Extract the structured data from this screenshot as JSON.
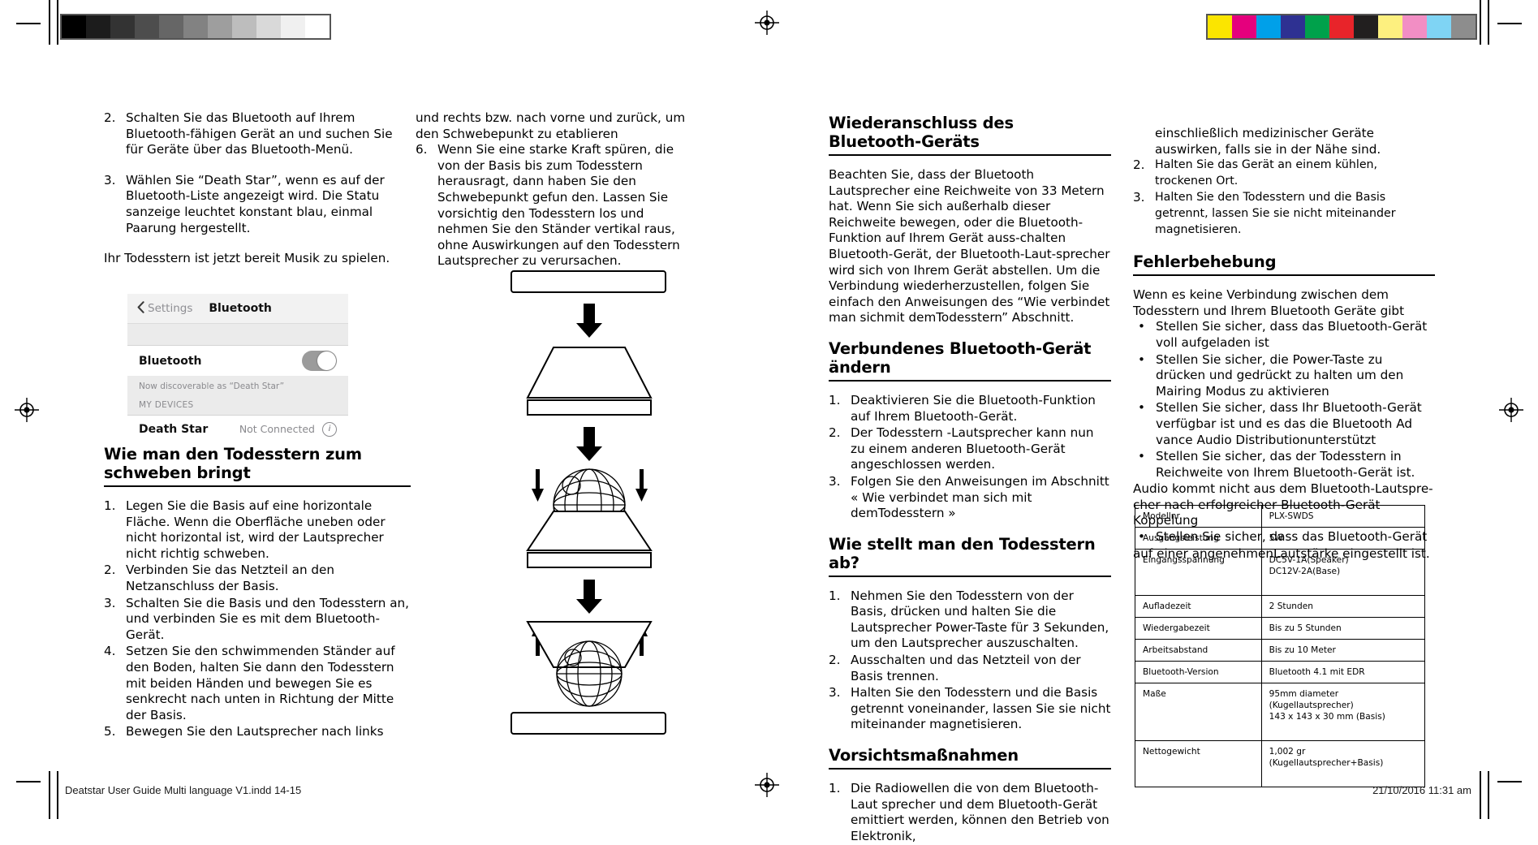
{
  "print_marks": {
    "footer_left": "Deatstar User Guide Multi language V1.indd   14-15",
    "footer_right": "21/10/2016   11:31 am",
    "gray_swatches": [
      "#000000",
      "#1c1c1c",
      "#333333",
      "#4d4d4d",
      "#666666",
      "#828282",
      "#9e9e9e",
      "#bdbdbd",
      "#d9d9d9",
      "#f0f0f0",
      "#ffffff"
    ],
    "color_swatches": [
      "#fbe500",
      "#e5007d",
      "#00a0e9",
      "#2e3192",
      "#00a14b",
      "#e8242a",
      "#221f1f",
      "#fdf07f",
      "#f28ec4",
      "#7fd4f4",
      "#8d8d8d"
    ],
    "registration_icon": "registration-target-icon"
  },
  "col1": {
    "items": [
      {
        "num": "2.",
        "text": "Schalten Sie das Bluetooth auf Ihrem Bluetooth-fähigen Gerät an und suchen Sie für Geräte über das Bluetooth-Menü."
      },
      {
        "num": "3.",
        "text": "Wählen Sie “Death Star”, wenn es auf der Bluetooth-Liste angezeigt wird. Die Statu sanzeige leuchtet konstant blau, einmal Paarung hergestellt."
      }
    ],
    "ready_note": "Ihr Todesstern ist jetzt bereit Musik zu spielen.",
    "bluetooth_mock": {
      "back_label": "Settings",
      "back_icon": "chevron-left-icon",
      "title": "Bluetooth",
      "toggle_label": "Bluetooth",
      "toggle_state": "on",
      "discoverable_note": "Now discoverable as “Death Star”",
      "section_header": "MY DEVICES",
      "device_name": "Death Star",
      "device_status": "Not Connected",
      "info_icon": "info-circle-icon"
    },
    "heading": "Wie man den Todesstern zum schweben bringt",
    "steps": [
      {
        "num": "1.",
        "text": "Legen Sie die Basis auf eine horizontale Fläche. Wenn die Oberfläche uneben oder nicht horizontal ist, wird der Lautsprecher nicht richtig schweben."
      },
      {
        "num": "2.",
        "text": "Verbinden Sie das Netzteil an den Netzanschluss der Basis."
      },
      {
        "num": "3.",
        "text": "Schalten Sie die Basis und den Todesstern an, und verbinden Sie es mit dem Bluetooth-Gerät."
      },
      {
        "num": "4.",
        "text": "Setzen Sie den schwimmenden Ständer auf den Boden, halten Sie dann den Todesstern mit beiden Händen und bewegen Sie es senkrecht nach unten in Richtung der Mitte der Basis."
      },
      {
        "num": "5.",
        "text": "Bewegen Sie den Lautsprecher nach links"
      }
    ]
  },
  "col2": {
    "continuation": "und rechts bzw. nach vorne und zurück, um den Schwebepunkt zu etablieren",
    "items": [
      {
        "num": "6.",
        "text": "Wenn Sie eine starke Kraft spüren, die von der Basis bis zum Todesstern herausragt, dann haben Sie den Schwebepunkt gefun den. Lassen Sie vorsichtig den Todesstern los und nehmen Sie den Ständer vertikal raus, ohne Auswirkungen auf den Todesstern Lautsprecher zu verursachen."
      }
    ],
    "illustration": "death-star-levitation-diagram"
  },
  "col3": {
    "heading1": "Wiederanschluss des Bluetooth-Geräts",
    "para1": "Beachten Sie, dass der Bluetooth Lautsprecher eine Reichweite von 33 Metern hat. Wenn Sie sich außerhalb dieser Reichweite bewegen, oder die Bluetooth-Funktion auf Ihrem Gerät auss-chalten Bluetooth-Gerät, der Bluetooth-Laut-sprecher wird sich von Ihrem Gerät abstellen. Um die Verbindung wiederherzustellen, folgen Sie einfach den Anweisungen des “Wie verbindet man sichmit demTodesstern” Abschnitt.",
    "heading2": "Verbundenes Bluetooth-Gerät ändern",
    "list2": [
      {
        "num": "1.",
        "text": "Deaktivieren Sie die Bluetooth-Funktion auf Ihrem Bluetooth-Gerät."
      },
      {
        "num": "2.",
        "text": "Der Todesstern -Lautsprecher kann nun zu einem anderen Bluetooth-Gerät angeschlossen werden."
      },
      {
        "num": "3.",
        "text": "Folgen Sie den Anweisungen im Abschnitt « Wie verbindet man sich mit demTodesstern »"
      }
    ],
    "heading3": "Wie stellt man den Todesstern ab?",
    "list3": [
      {
        "num": "1.",
        "text": "Nehmen Sie den Todesstern von der Basis, drücken und halten Sie die Lautsprecher Power-Taste für 3 Sekunden, um den Lautsprecher auszuschalten."
      },
      {
        "num": "2.",
        "text": "Ausschalten und das Netzteil von der Basis trennen."
      },
      {
        "num": "3.",
        "text": "Halten Sie den Todesstern und die Basis getrennt voneinander, lassen Sie sie nicht miteinander magnetisieren."
      }
    ],
    "heading4": "Vorsichtsmaßnahmen",
    "list4": [
      {
        "num": "1.",
        "text": "Die Radiowellen die von dem Bluetooth-Laut sprecher und dem Bluetooth-Gerät emittiert werden, können den Betrieb von Elektronik,"
      }
    ]
  },
  "col4": {
    "continuation": "einschließlich medizinischer Geräte auswirken, falls sie in der Nähe sind.",
    "list_top": [
      {
        "num": "2.",
        "text": "Halten Sie das Gerät an einem kühlen, trockenen Ort."
      },
      {
        "num": "3.",
        "text": "Halten Sie den Todesstern und die Basis getrennt, lassen Sie sie nicht miteinander magnetisieren."
      }
    ],
    "heading": "Fehlerbehebung",
    "intro": "Wenn es keine Verbindung zwischen dem Todesstern und Ihrem Bluetooth Geräte gibt",
    "bullets": [
      {
        "num": "•",
        "text": "Stellen Sie sicher, dass das Bluetooth-Gerät voll aufgeladen ist"
      },
      {
        "num": "•",
        "text": "Stellen Sie sicher, die Power-Taste zu drücken und gedrückt zu halten um den Mairing Modus zu aktivieren"
      },
      {
        "num": "•",
        "text": "Stellen Sie sicher, dass Ihr Bluetooth-Gerät verfügbar ist und es das die Bluetooth Ad vance Audio Distributionunterstützt"
      },
      {
        "num": "•",
        "text": "Stellen Sie sicher, das der Todesstern in Reichweite von Ihrem Bluetooth-Gerät ist."
      }
    ],
    "para_after": "Audio kommt nicht aus dem Bluetooth-Lautspre-cher nach erfolgreicher Bluetooth-Gerät Koppelung",
    "bullet_last": {
      "num": "•",
      "text": "Stellen Sie sicher, dass das Bluetooth-Gerät"
    },
    "para_last": "auf einer angenehmenLautstärke eingestellt ist.",
    "spec_table": {
      "rows": [
        {
          "key": "Modellnr.",
          "value": "PLX-SWDS"
        },
        {
          "key": "Ausgangsleistung",
          "value": "5W"
        },
        {
          "key": "Eingangsspannung",
          "value": "DC5V-1A(Speaker)\nDC12V-2A(Base)"
        },
        {
          "key": "Aufladezeit",
          "value": "2 Stunden"
        },
        {
          "key": "Wiedergabezeit",
          "value": "Bis zu 5 Stunden"
        },
        {
          "key": "Arbeitsabstand",
          "value": "Bis zu 10 Meter"
        },
        {
          "key": "Bluetooth-Version",
          "value": "Bluetooth 4.1 mit EDR"
        },
        {
          "key": "Maße",
          "value": "95mm diameter\n(Kugellautsprecher)\n143 x 143 x 30 mm (Basis)"
        },
        {
          "key": "Nettogewicht",
          "value": "1,002 gr (Kugellautsprecher+Basis)"
        }
      ]
    }
  }
}
